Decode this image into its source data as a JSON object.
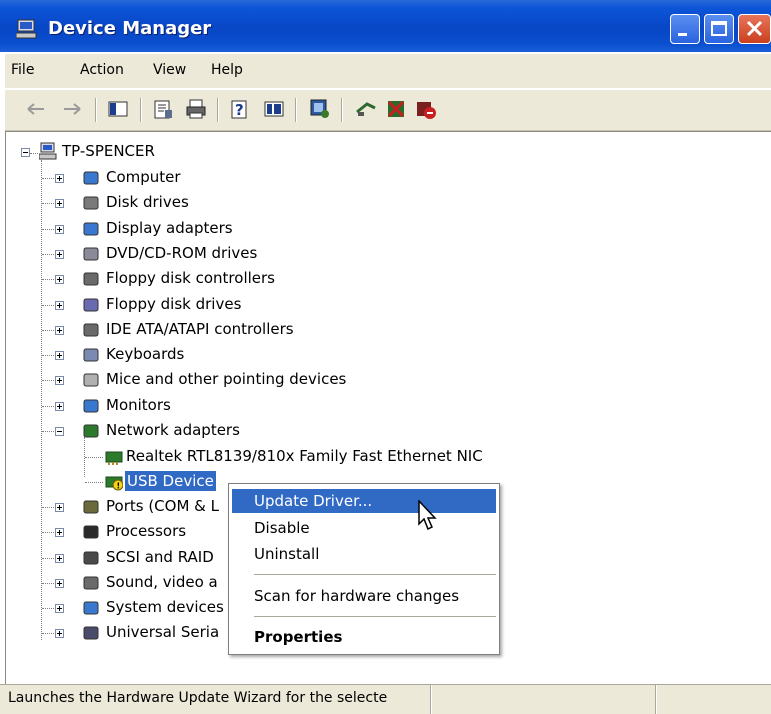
{
  "window": {
    "title": "Device Manager"
  },
  "menu": [
    "File",
    "Action",
    "View",
    "Help"
  ],
  "toolbar_icons": [
    "back-arrow-icon",
    "forward-arrow-icon",
    "show-hide-tree-icon",
    "properties-icon",
    "print-icon",
    "help-icon",
    "view-icon",
    "scan-hardware-icon",
    "update-driver-icon",
    "disable-device-icon",
    "uninstall-device-icon"
  ],
  "tree": {
    "root": "TP-SPENCER",
    "categories": [
      "Computer",
      "Disk drives",
      "Display adapters",
      "DVD/CD-ROM drives",
      "Floppy disk controllers",
      "Floppy disk drives",
      "IDE ATA/ATAPI controllers",
      "Keyboards",
      "Mice and other pointing devices",
      "Monitors",
      "Network adapters",
      "Ports (COM & L",
      "Processors",
      "SCSI and RAID",
      "Sound, video a",
      "System devices",
      "Universal Seria"
    ],
    "network_children": [
      "Realtek RTL8139/810x Family Fast Ethernet NIC",
      "USB Device"
    ]
  },
  "context_menu": {
    "items": [
      "Update Driver...",
      "Disable",
      "Uninstall",
      "Scan for hardware changes",
      "Properties"
    ],
    "highlighted": "Update Driver..."
  },
  "status": "Launches the Hardware Update Wizard for the selecte",
  "colors": {
    "titlebar": "#0846c5",
    "selection": "#316ac5",
    "chrome": "#ece9d8"
  }
}
